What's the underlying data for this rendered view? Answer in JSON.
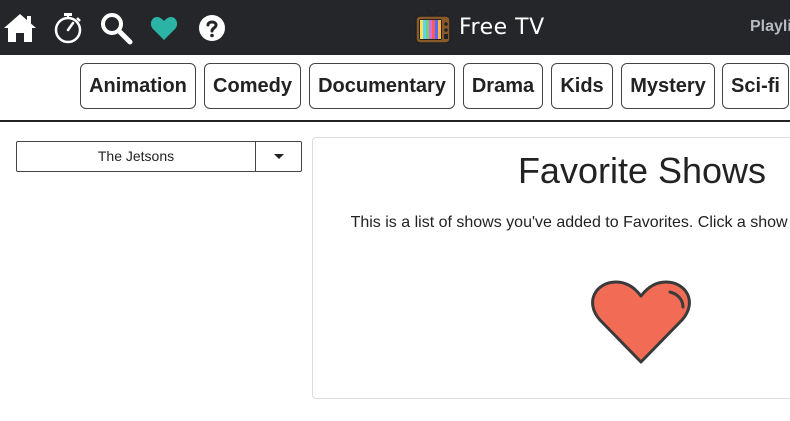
{
  "header": {
    "brand": "Free TV",
    "playlist_label": "Playli",
    "icons": [
      "home-icon",
      "stopwatch-icon",
      "search-icon",
      "heart-icon",
      "help-icon"
    ],
    "active_color": "#2bb3a5"
  },
  "genres": [
    "Animation",
    "Comedy",
    "Documentary",
    "Drama",
    "Kids",
    "Mystery",
    "Sci-fi"
  ],
  "show_select": {
    "value": "The Jetsons"
  },
  "favorites": {
    "title": "Favorite Shows",
    "description": "This is a list of shows you've added to Favorites. Click a show ti watching more Free TV.",
    "heart_color": "#f26b55"
  }
}
